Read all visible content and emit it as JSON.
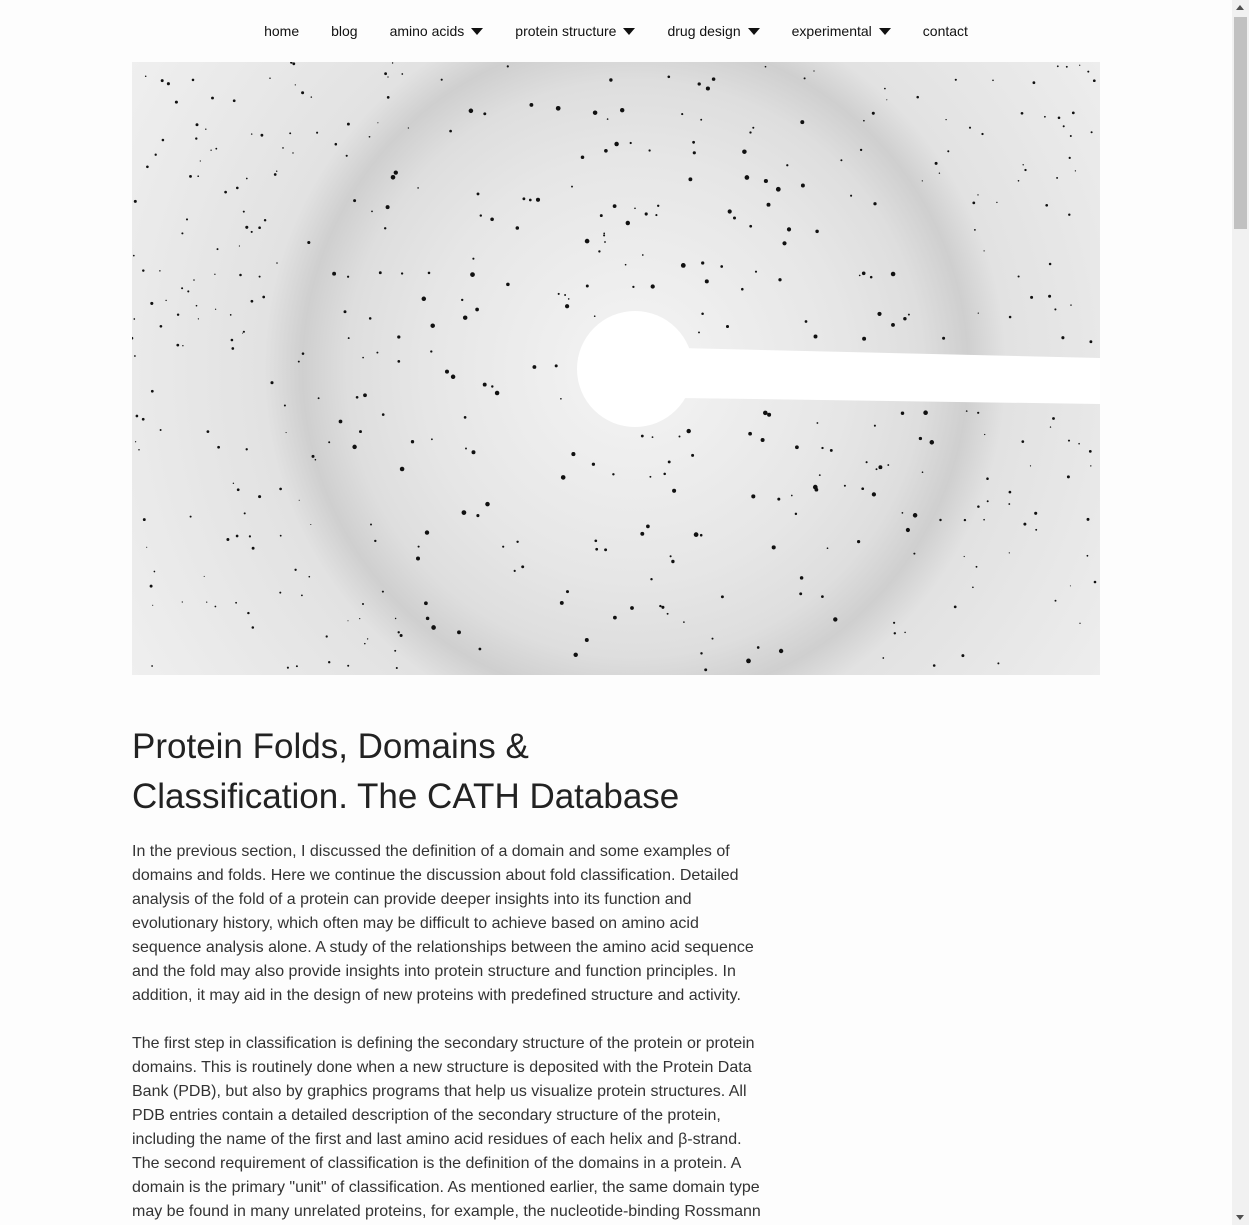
{
  "nav": {
    "items": [
      {
        "label": "home",
        "dropdown": false
      },
      {
        "label": "blog",
        "dropdown": false
      },
      {
        "label": "amino acids",
        "dropdown": true
      },
      {
        "label": "protein structure",
        "dropdown": true
      },
      {
        "label": "drug design",
        "dropdown": true
      },
      {
        "label": "experimental",
        "dropdown": true
      },
      {
        "label": "contact",
        "dropdown": false
      }
    ]
  },
  "hero": {
    "description_icon": "x-ray-diffraction-pattern-image"
  },
  "article": {
    "title": "Protein Folds, Domains & Classification. The CATH Database",
    "paragraphs": [
      "In the previous section, I discussed the definition of a domain and some examples of domains and folds. Here we continue the discussion about fold classification. Detailed analysis of the fold of a protein can provide deeper insights into its function and evolutionary history, which often may be difficult to achieve based on amino acid sequence analysis alone. A study of the relationships between the amino acid sequence and the fold may also provide insights into protein structure and function principles. In addition, it may aid in the design of new proteins with predefined structure and activity.",
      "The first step in classification is defining the secondary structure of the protein or protein domains. This is routinely done when a new structure is deposited with the Protein Data Bank (PDB), but also by graphics programs that help us visualize protein structures. All PDB entries contain a detailed description of the secondary structure of the protein, including the name of the first and last amino acid residues of each helix and β-strand. The second requirement of classification is the definition of the domains in a protein. A domain is the primary \"unit\" of classification. As mentioned earlier, the same domain type may be found in many unrelated proteins, for example, the nucleotide-binding Rossmann fold domain. For this reason, it is not meant to base the classification on the whole protein"
    ]
  },
  "colors": {
    "background": "#fdfdfd",
    "text": "#222222",
    "hero_gray": "#dcdcdc",
    "spot": "#111111"
  }
}
